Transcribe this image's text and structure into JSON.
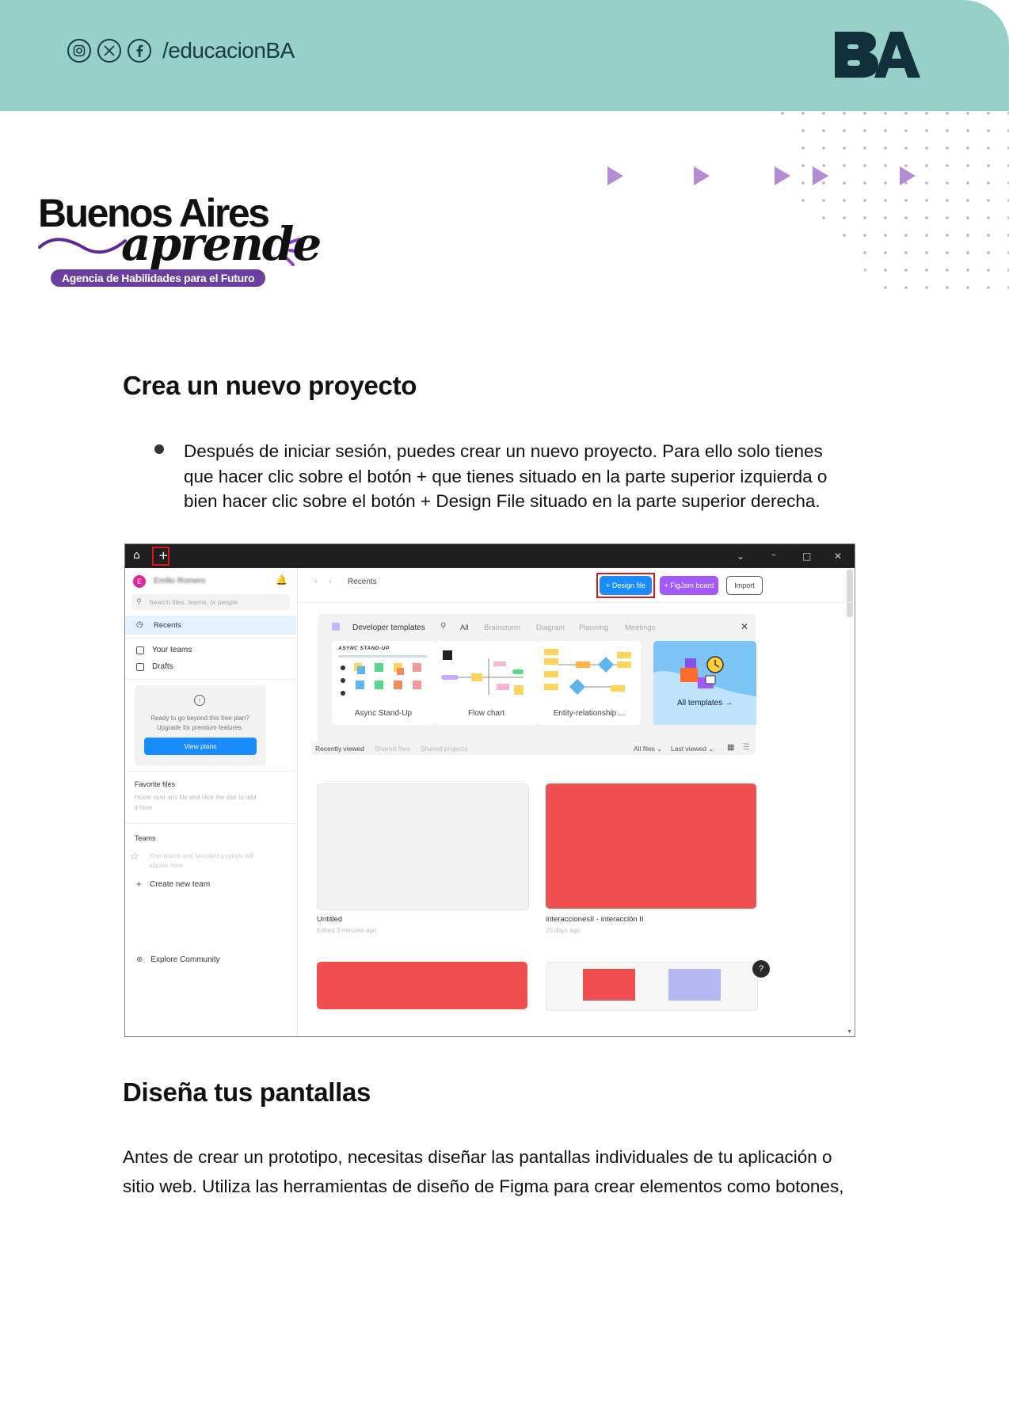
{
  "header": {
    "social_handle": "/educacionBA",
    "social_icons": [
      "instagram-icon",
      "x-icon",
      "facebook-icon"
    ],
    "brand_mark": "BA",
    "background_color": "#97d0c8"
  },
  "logo": {
    "line1": "Buenos Aires",
    "line2": "aprende",
    "tagline": "Agencia de Habilidades para el Futuro"
  },
  "section1": {
    "heading": "Crea un nuevo proyecto",
    "bullet_lines": [
      "Después de iniciar sesión, puedes crear un nuevo proyecto. Para ello solo tienes",
      "que hacer clic sobre el botón + que tienes situado en la parte superior izquierda o",
      "bien hacer clic sobre el botón + Design File situado en la parte superior derecha."
    ]
  },
  "figma": {
    "plus": "+",
    "user_name": "Emilio Romero",
    "search_placeholder": "Search files, teams, or people",
    "nav_recents": "Recents",
    "nav_teams": "Your teams",
    "nav_drafts": "Drafts",
    "upgrade_text1": "Ready to go beyond this free plan?",
    "upgrade_text2": "Upgrade for premium features.",
    "view_plans": "View plans",
    "favorite_title": "Favorite files",
    "favorite_hint1": "Hover over any file and click the star to add",
    "favorite_hint2": "it here",
    "teams_title": "Teams",
    "teams_hint1": "Your teams and favorited projects will",
    "teams_hint2": "appear here",
    "create_team": "Create new team",
    "explore": "Explore Community",
    "breadcrumb": "Recents",
    "design_file_btn": "+ Design file",
    "figjam_btn": "+ FigJam board",
    "import_btn": "Import",
    "templates_title": "Developer templates",
    "filters": [
      "All",
      "Brainstorm",
      "Diagram",
      "Planning",
      "Meetings"
    ],
    "templates": [
      "Async Stand-Up",
      "Flow chart",
      "Entity-relationship ...",
      "All templates →"
    ],
    "async_header": "ASYNC STAND-UP",
    "file_tabs": [
      "Recently viewed",
      "Shared files",
      "Shared projects"
    ],
    "sort_all": "All files ⌄",
    "sort_last": "Last viewed ⌄",
    "files": [
      {
        "name": "Untitled",
        "meta": "Edited 3 minutes ago"
      },
      {
        "name": "interaccionesII - interacción II",
        "meta": "20 days ago"
      }
    ],
    "help": "?",
    "accent_blue": "#1a8cff",
    "accent_purple": "#a259ff",
    "thumb_red": "#f04f4f"
  },
  "section2": {
    "heading": "Diseña tus pantallas",
    "lines": [
      "Antes de crear un prototipo, necesitas diseñar las pantallas individuales de tu aplicación o",
      "sitio web. Utiliza las herramientas de diseño de Figma para crear elementos como botones,"
    ]
  }
}
